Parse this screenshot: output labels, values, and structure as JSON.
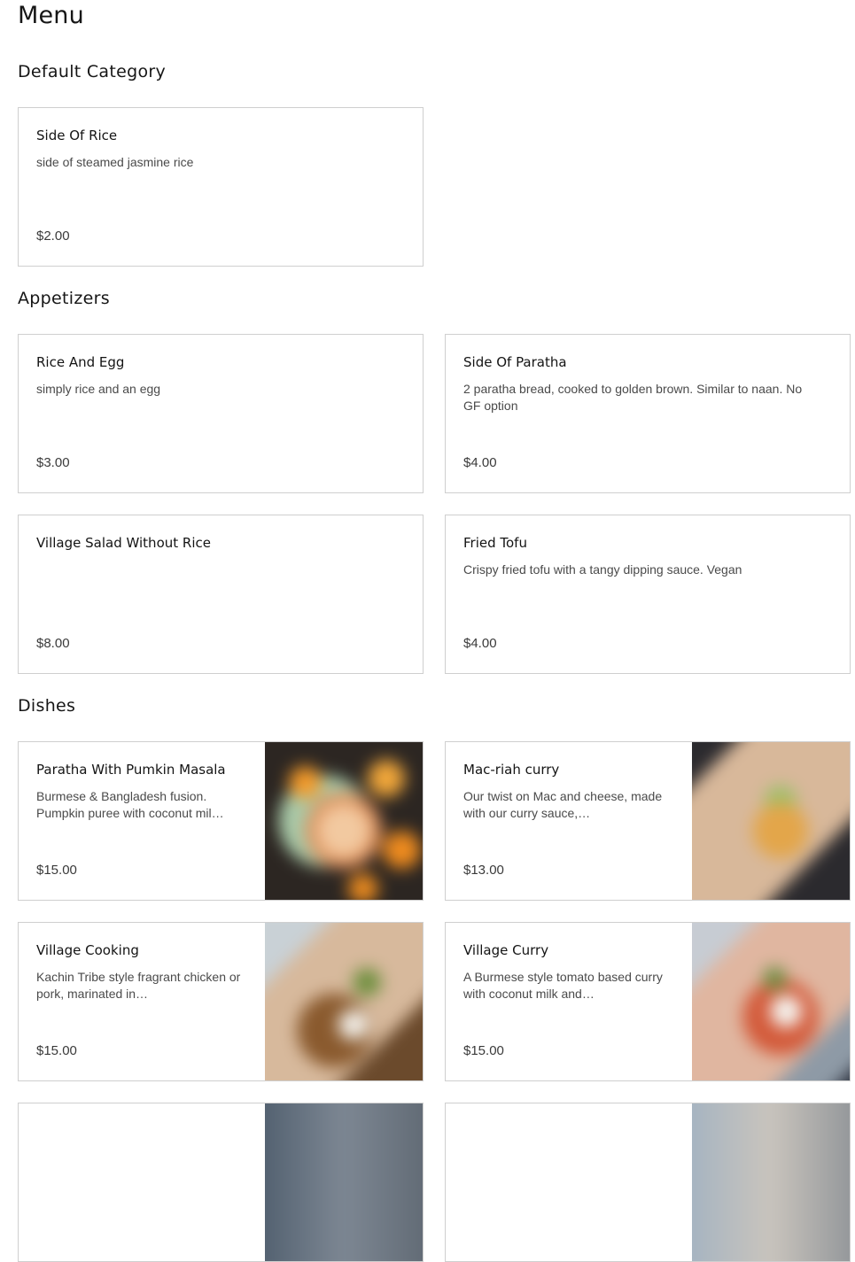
{
  "page_title": "Menu",
  "sections": [
    {
      "title": "Default Category",
      "items": [
        {
          "name": "Side Of Rice",
          "description": "side of steamed jasmine rice",
          "price": "$2.00"
        }
      ]
    },
    {
      "title": "Appetizers",
      "items": [
        {
          "name": "Rice And Egg",
          "description": "simply rice and an egg",
          "price": "$3.00"
        },
        {
          "name": "Side Of Paratha",
          "description": "2 paratha bread, cooked to golden brown. Similar to naan. No GF option",
          "price": "$4.00"
        },
        {
          "name": "Village Salad Without Rice",
          "description": "",
          "price": "$8.00"
        },
        {
          "name": "Fried Tofu",
          "description": "Crispy fried tofu with a tangy dipping sauce. Vegan",
          "price": "$4.00"
        }
      ]
    },
    {
      "title": "Dishes",
      "items": [
        {
          "name": "Paratha With Pumkin Masala",
          "description": "Burmese & Bangladesh fusion. Pumpkin puree with coconut mil…",
          "price": "$15.00",
          "image": "pumpkin-masala-photo"
        },
        {
          "name": "Mac-riah curry",
          "description": "Our twist on Mac and cheese, made with our curry sauce,…",
          "price": "$13.00",
          "image": "mac-riah-curry-photo"
        },
        {
          "name": "Village Cooking",
          "description": "Kachin Tribe style fragrant chicken or pork, marinated in…",
          "price": "$15.00",
          "image": "village-cooking-photo"
        },
        {
          "name": "Village Curry",
          "description": "A Burmese style tomato based curry with coconut milk and…",
          "price": "$15.00",
          "image": "village-curry-photo"
        }
      ]
    }
  ]
}
